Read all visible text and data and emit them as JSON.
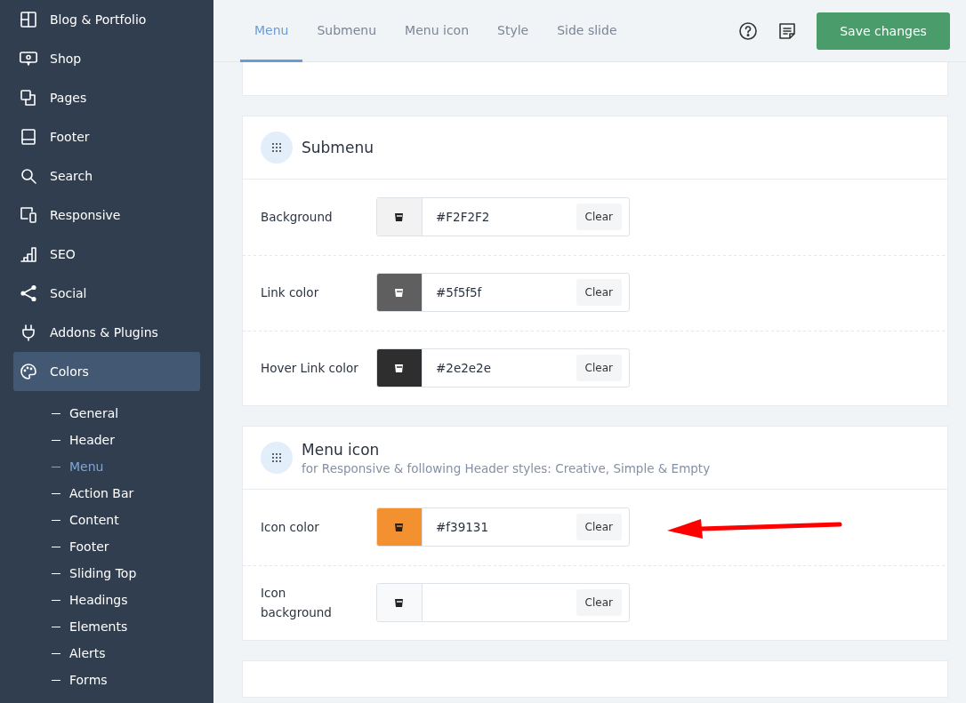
{
  "sidebar": {
    "items": [
      {
        "label": "Blog & Portfolio",
        "selected": false
      },
      {
        "label": "Shop",
        "selected": false
      },
      {
        "label": "Pages",
        "selected": false
      },
      {
        "label": "Footer",
        "selected": false
      },
      {
        "label": "Search",
        "selected": false
      },
      {
        "label": "Responsive",
        "selected": false
      },
      {
        "label": "SEO",
        "selected": false
      },
      {
        "label": "Social",
        "selected": false
      },
      {
        "label": "Addons & Plugins",
        "selected": false
      },
      {
        "label": "Colors",
        "selected": true,
        "children": [
          {
            "label": "General",
            "selected": false
          },
          {
            "label": "Header",
            "selected": false
          },
          {
            "label": "Menu",
            "selected": true
          },
          {
            "label": "Action Bar",
            "selected": false
          },
          {
            "label": "Content",
            "selected": false
          },
          {
            "label": "Footer",
            "selected": false
          },
          {
            "label": "Sliding Top",
            "selected": false
          },
          {
            "label": "Headings",
            "selected": false
          },
          {
            "label": "Elements",
            "selected": false
          },
          {
            "label": "Alerts",
            "selected": false
          },
          {
            "label": "Forms",
            "selected": false
          }
        ]
      }
    ]
  },
  "tabs": [
    {
      "label": "Menu",
      "selected": true
    },
    {
      "label": "Submenu",
      "selected": false
    },
    {
      "label": "Menu icon",
      "selected": false
    },
    {
      "label": "Style",
      "selected": false
    },
    {
      "label": "Side slide",
      "selected": false
    }
  ],
  "save_button": "Save changes",
  "sections": [
    {
      "title": "Submenu",
      "fields": [
        {
          "label": "Background",
          "value": "#F2F2F2",
          "color": "#f2f2f2",
          "clear": "Clear"
        },
        {
          "label": "Link color",
          "value": "#5f5f5f",
          "color": "#5f5f5f",
          "clear": "Clear"
        },
        {
          "label": "Hover Link color",
          "value": "#2e2e2e",
          "color": "#2e2e2e",
          "clear": "Clear"
        }
      ]
    },
    {
      "title": "Menu icon",
      "subtitle": "for Responsive & following Header styles: Creative, Simple & Empty",
      "fields": [
        {
          "label": "Icon color",
          "value": "#f39131",
          "color": "#f39131",
          "clear": "Clear"
        },
        {
          "label": "Icon background",
          "color": "#f8f9fa",
          "clear": "Clear"
        }
      ]
    }
  ]
}
